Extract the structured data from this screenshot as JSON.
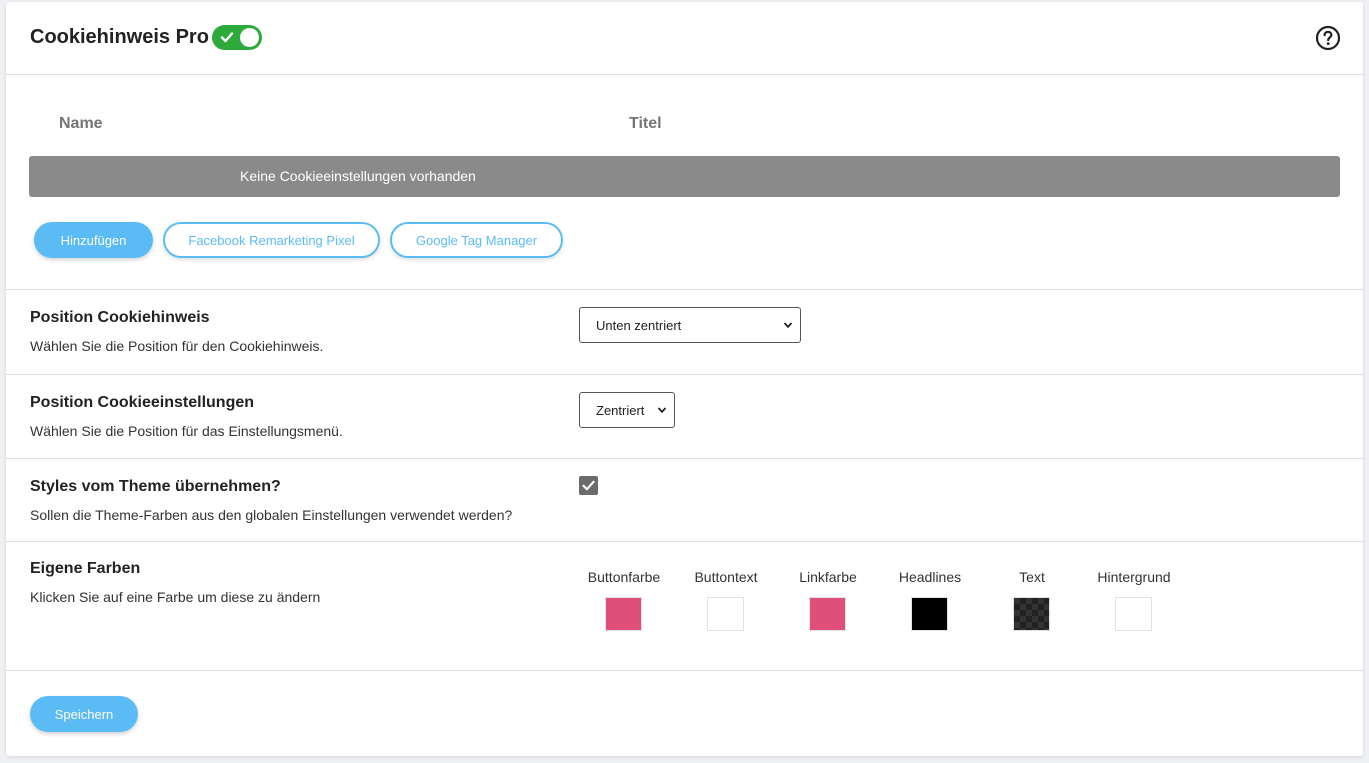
{
  "header": {
    "title": "Cookiehinweis Pro",
    "toggle_on": true,
    "help_icon": "question-circle-icon"
  },
  "table": {
    "columns": [
      "Name",
      "Titel"
    ],
    "empty_message": "Keine Cookieeinstellungen vorhanden"
  },
  "actions": {
    "add_label": "Hinzufügen",
    "facebook_label": "Facebook Remarketing Pixel",
    "gtm_label": "Google Tag Manager"
  },
  "settings": {
    "position_notice": {
      "title": "Position Cookiehinweis",
      "description": "Wählen Sie die Position für den Cookiehinweis.",
      "selected": "Unten zentriert"
    },
    "position_settings": {
      "title": "Position Cookieeinstellungen",
      "description": "Wählen Sie die Position für das Einstellungsmenü.",
      "selected": "Zentriert"
    },
    "theme_styles": {
      "title": "Styles vom Theme übernehmen?",
      "description": "Sollen die Theme-Farben aus den globalen Einstellungen verwendet werden?",
      "checked": true
    },
    "colors": {
      "title": "Eigene Farben",
      "description": "Klicken Sie auf eine Farbe um diese zu ändern",
      "swatches": [
        {
          "label": "Buttonfarbe",
          "color": "#e04f7a"
        },
        {
          "label": "Buttontext",
          "color": "#ffffff"
        },
        {
          "label": "Linkfarbe",
          "color": "#e04f7a"
        },
        {
          "label": "Headlines",
          "color": "#000000"
        },
        {
          "label": "Text",
          "color": "#2b2b2b"
        },
        {
          "label": "Hintergrund",
          "color": "#ffffff"
        }
      ]
    }
  },
  "footer": {
    "save_label": "Speichern"
  },
  "theme": {
    "accent": "#5bbcf5",
    "toggle_on_color": "#2eaa3c",
    "empty_bar_color": "#8a8a8a"
  }
}
